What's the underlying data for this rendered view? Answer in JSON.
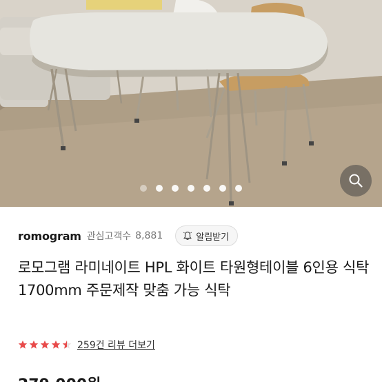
{
  "photo": {
    "alt_name": "product-photo",
    "carousel_dot_count": 8,
    "active_dot_index": 0
  },
  "icons": {
    "zoom": "search-icon",
    "bell": "bell-icon",
    "star": "star-icon"
  },
  "seller": {
    "name": "romogram",
    "interest_label": "관심고객수",
    "interest_count": "8,881",
    "alert_button_label": "알림받기"
  },
  "product": {
    "title": "로모그램 라미네이트 HPL 화이트 타원형테이블 6인용 식탁 1700mm 주문제작 맞춤 가능 식탁",
    "price_partial": "279,000원"
  },
  "rating": {
    "stars": 4.5,
    "max_stars": 5,
    "review_text": "259건 리뷰 더보기"
  },
  "colors": {
    "star": "#e84a4a",
    "text_primary": "#1a1a1a",
    "text_secondary": "#777777"
  }
}
